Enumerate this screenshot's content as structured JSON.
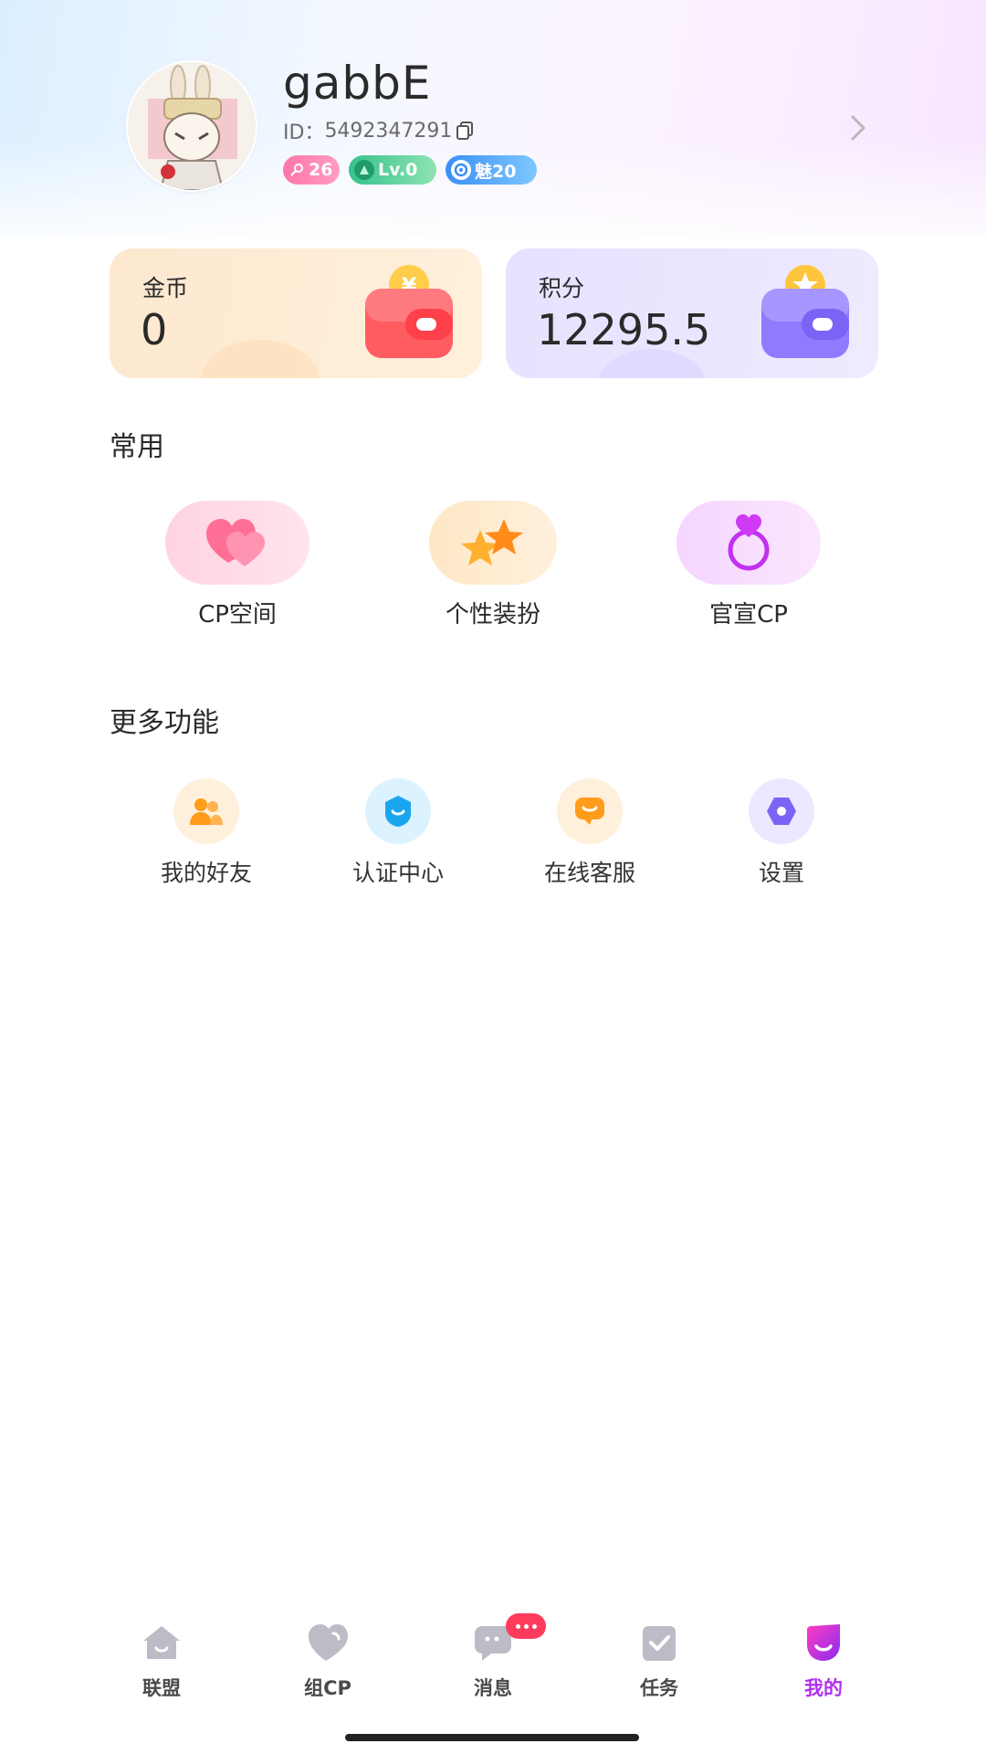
{
  "profile": {
    "username": "gabbE",
    "id_label": "ID：",
    "id_value": "5492347291",
    "badges": {
      "flower": "26",
      "level": "Lv.0",
      "charm": "魅20"
    }
  },
  "wallet": {
    "coins": {
      "label": "金币",
      "value": "0"
    },
    "points": {
      "label": "积分",
      "value": "12295.5"
    }
  },
  "common": {
    "title": "常用",
    "items": [
      {
        "label": "CP空间",
        "icon": "hearts-icon"
      },
      {
        "label": "个性装扮",
        "icon": "stars-icon"
      },
      {
        "label": "官宣CP",
        "icon": "ring-icon"
      }
    ]
  },
  "more": {
    "title": "更多功能",
    "items": [
      {
        "label": "我的好友",
        "icon": "friends-icon"
      },
      {
        "label": "认证中心",
        "icon": "shield-icon"
      },
      {
        "label": "在线客服",
        "icon": "chat-icon"
      },
      {
        "label": "设置",
        "icon": "gear-icon"
      }
    ]
  },
  "tabbar": {
    "tabs": [
      {
        "label": "联盟",
        "icon": "home-icon"
      },
      {
        "label": "组CP",
        "icon": "heart-icon"
      },
      {
        "label": "消息",
        "icon": "message-icon"
      },
      {
        "label": "任务",
        "icon": "task-icon"
      },
      {
        "label": "我的",
        "icon": "profile-icon"
      }
    ],
    "active": "我的"
  },
  "colors": {
    "accent": "#b02ff0",
    "coin_card": "#fde8cf",
    "points_card": "#e6e2ff",
    "notification": "#ff3b5c"
  }
}
